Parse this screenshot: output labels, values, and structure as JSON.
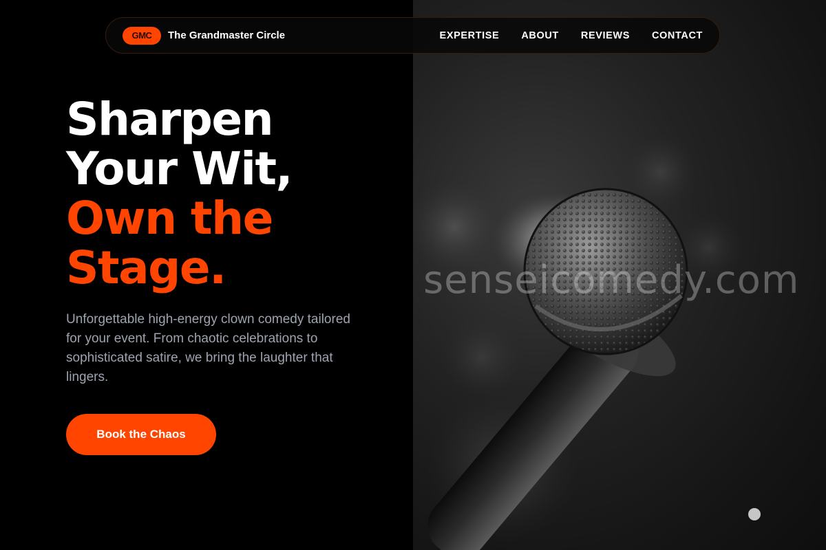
{
  "brand": {
    "logo_text": "GMC",
    "name": "The Grandmaster Circle"
  },
  "nav": {
    "items": [
      "EXPERTISE",
      "ABOUT",
      "REVIEWS",
      "CONTACT"
    ]
  },
  "hero": {
    "heading_white": [
      "Sharpen",
      "Your Wit,"
    ],
    "heading_accent": [
      "Own the",
      "Stage."
    ],
    "description": "Unforgettable high-energy clown comedy tailored for your event. From chaotic celebrations to sophisticated satire, we bring the laughter that lingers.",
    "cta_label": "Book the Chaos",
    "image_alt": "microphone-photo"
  },
  "watermark": "senseicomedy.com",
  "colors": {
    "accent": "#ff4500",
    "background": "#000000",
    "muted_text": "#9ea3b0"
  }
}
